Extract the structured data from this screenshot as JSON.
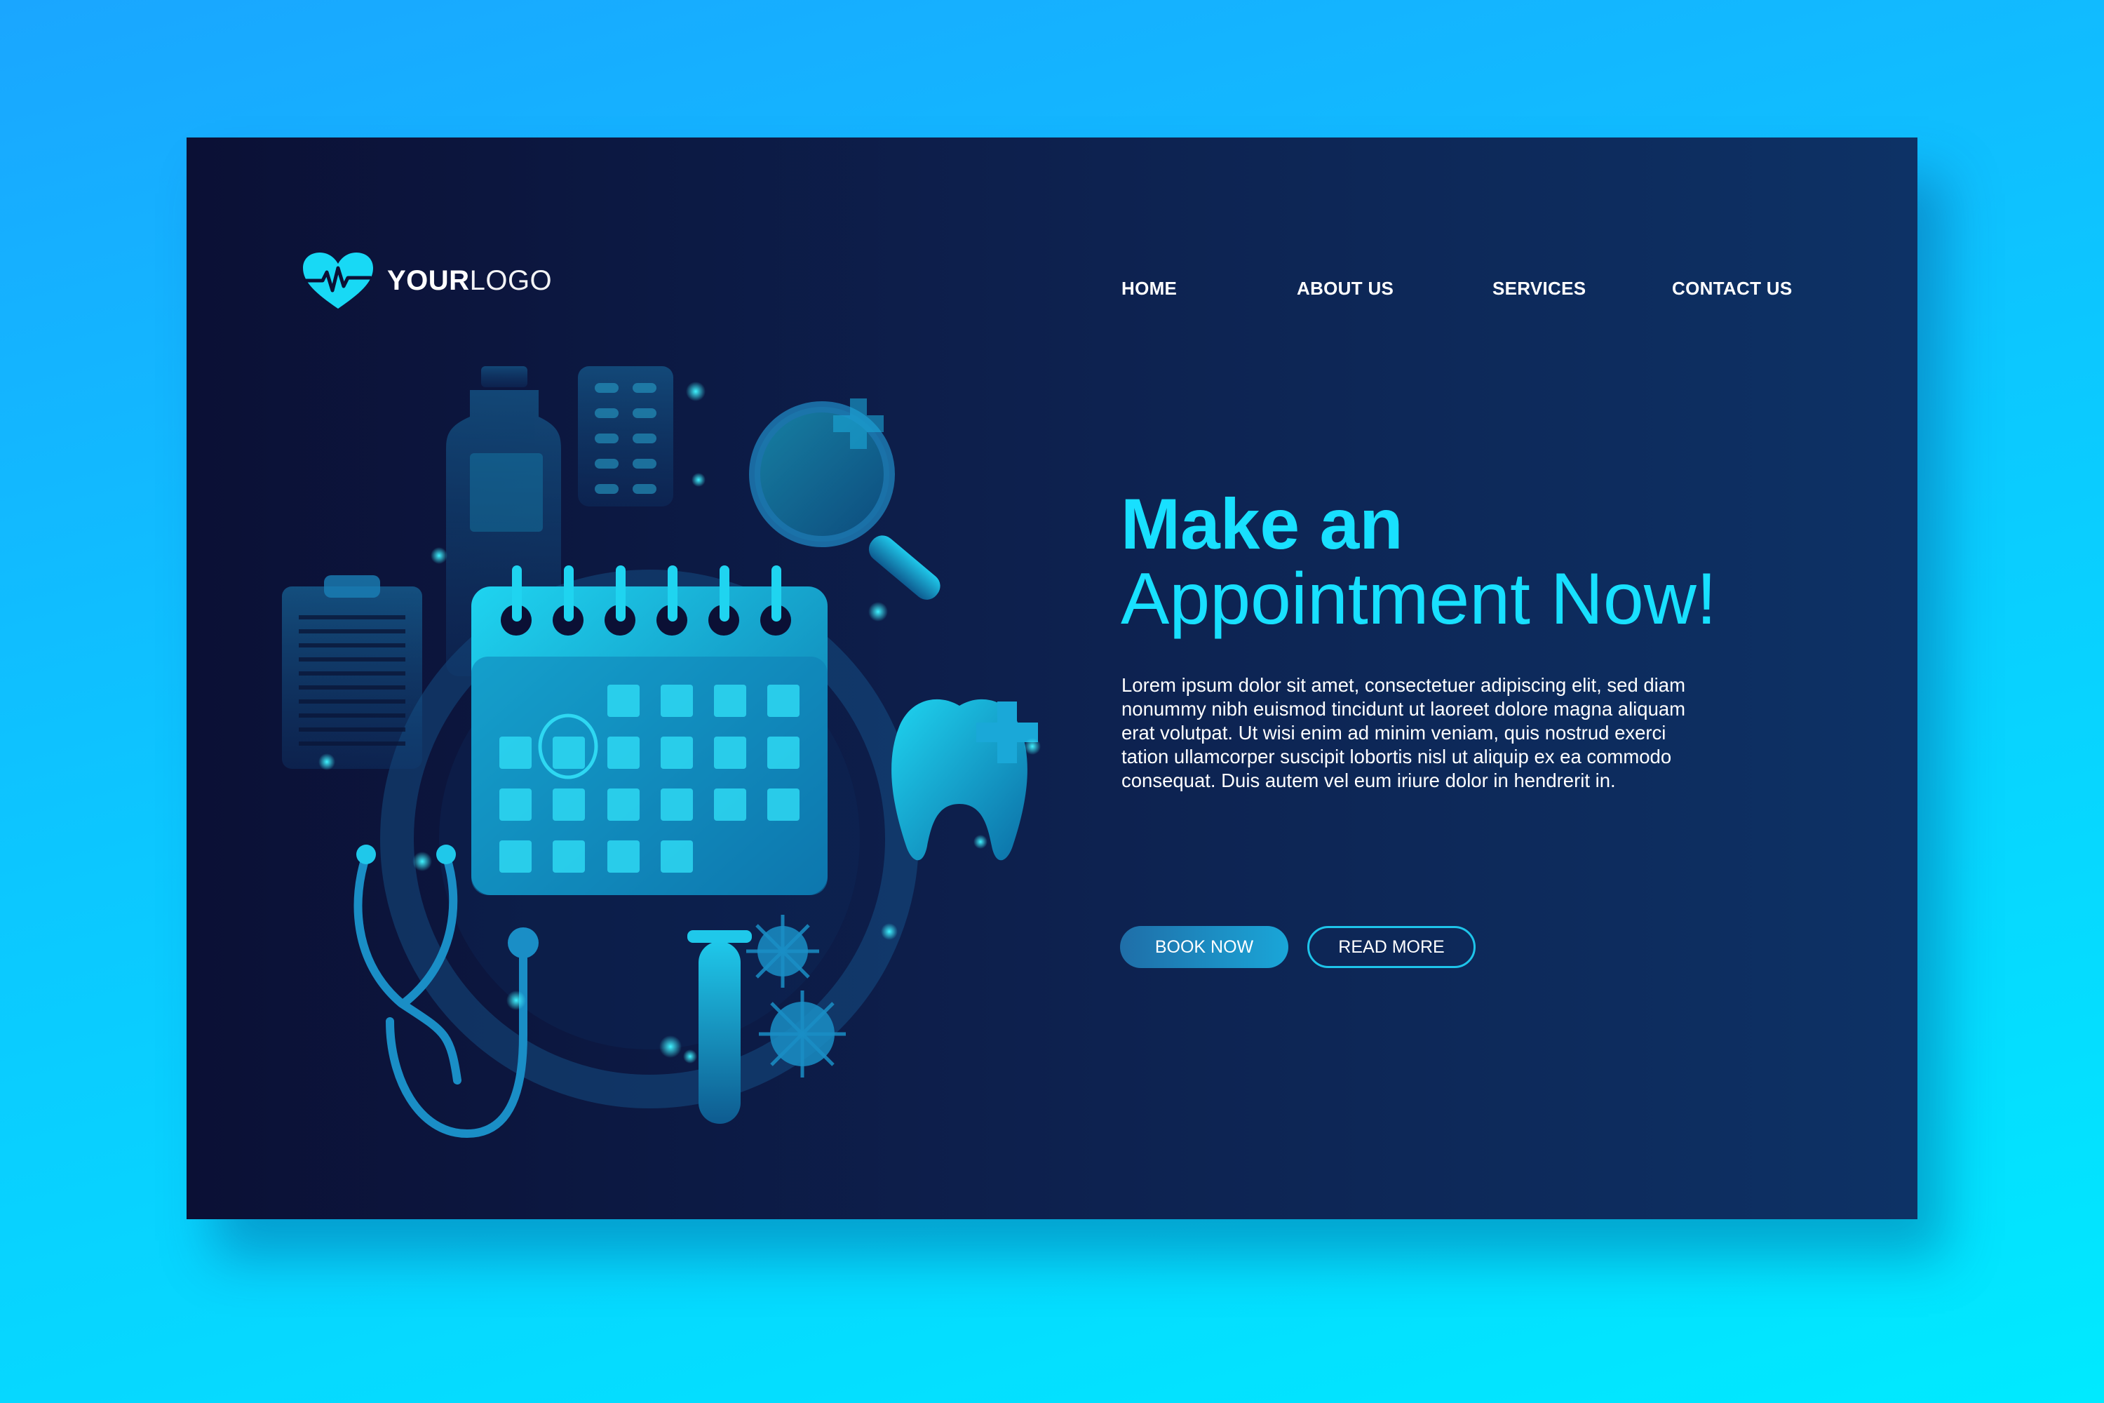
{
  "brand": {
    "logo_bold": "YOUR",
    "logo_light": "LOGO",
    "icon": "heartbeat-heart-icon"
  },
  "nav": {
    "items": [
      {
        "label": "HOME"
      },
      {
        "label": "ABOUT US"
      },
      {
        "label": "SERVICES"
      },
      {
        "label": "CONTACT US"
      }
    ]
  },
  "hero": {
    "headline_line1": "Make an",
    "headline_line2": "Appointment Now!",
    "body": "Lorem ipsum dolor sit amet, consectetuer adipiscing elit, sed diam nonummy nibh euismod tincidunt ut laoreet dolore magna aliquam erat volutpat. Ut wisi enim ad minim veniam, quis nostrud exerci tation ullamcorper suscipit lobortis nisl ut aliquip ex ea commodo consequat. Duis autem vel eum iriure dolor in hendrerit in.",
    "primary_button": "BOOK NOW",
    "secondary_button": "READ MORE"
  },
  "illustration": {
    "icons": [
      "medicine-bottle-icon",
      "pill-blister-icon",
      "magnifier-icon",
      "clipboard-icon",
      "calendar-icon",
      "tooth-icon",
      "stethoscope-icon",
      "test-tube-icon",
      "virus-icon"
    ]
  },
  "colors": {
    "accent": "#18e0ff",
    "card_dark": "#0b1035",
    "card_light": "#0d3266",
    "page_bg": "#0cc7ff"
  }
}
